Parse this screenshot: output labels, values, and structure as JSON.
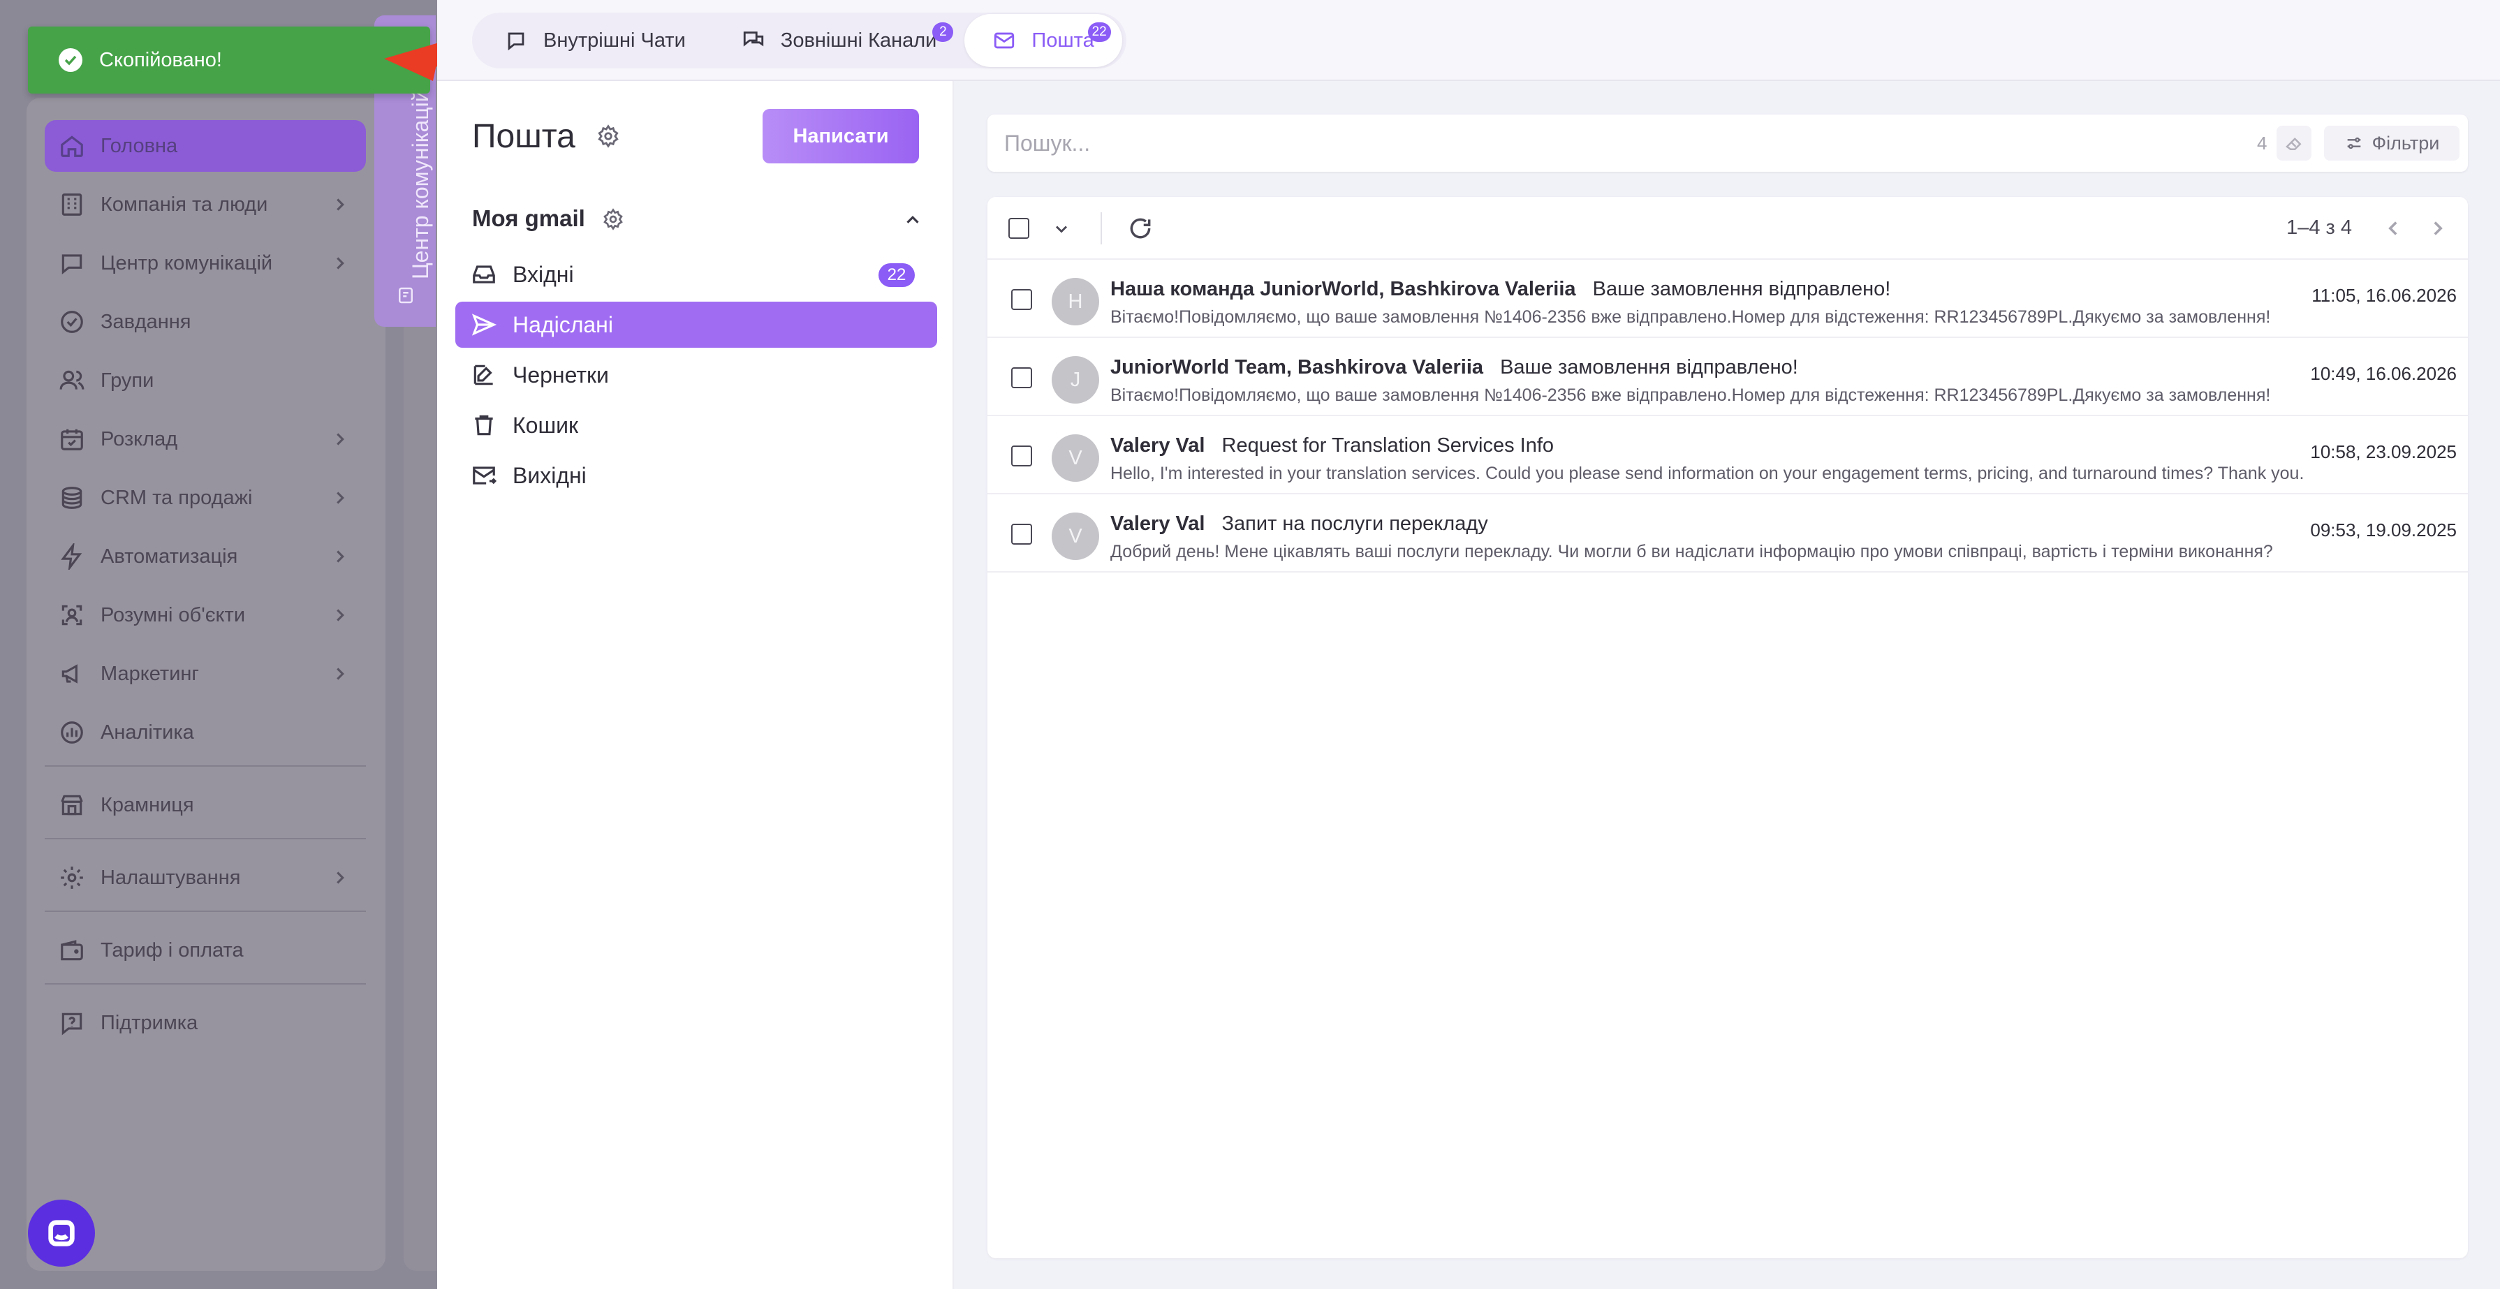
{
  "toast": {
    "message": "Скопійовано!"
  },
  "sidebar": {
    "vertical_tab": "Центр комунікацій",
    "items": [
      {
        "label": "Головна",
        "icon": "home-icon",
        "chevron": false
      },
      {
        "label": "Компанія та люди",
        "icon": "building-icon",
        "chevron": true
      },
      {
        "label": "Центр комунікацій",
        "icon": "chat-icon",
        "chevron": true
      },
      {
        "label": "Завдання",
        "icon": "check-circle-icon",
        "chevron": false
      },
      {
        "label": "Групи",
        "icon": "users-icon",
        "chevron": false
      },
      {
        "label": "Розклад",
        "icon": "calendar-icon",
        "chevron": true
      },
      {
        "label": "CRM та продажі",
        "icon": "coins-icon",
        "chevron": true
      },
      {
        "label": "Автоматизація",
        "icon": "bolt-icon",
        "chevron": true
      },
      {
        "label": "Розумні об'єкти",
        "icon": "scan-icon",
        "chevron": true
      },
      {
        "label": "Маркетинг",
        "icon": "megaphone-icon",
        "chevron": true
      },
      {
        "label": "Аналітика",
        "icon": "chart-icon",
        "chevron": false
      }
    ],
    "store": "Крамниця",
    "settings": "Налаштування",
    "billing": "Тариф і оплата",
    "support": "Підтримка"
  },
  "tabs": [
    {
      "label": "Внутрішні Чати",
      "badge": ""
    },
    {
      "label": "Зовнішні Канали",
      "badge": "2"
    },
    {
      "label": "Пошта",
      "badge": "22"
    }
  ],
  "mail": {
    "title": "Пошта",
    "compose_label": "Написати",
    "account": "Моя gmail",
    "folders": [
      {
        "label": "Вхідні",
        "badge": "22"
      },
      {
        "label": "Надіслані",
        "badge": ""
      },
      {
        "label": "Чернетки",
        "badge": ""
      },
      {
        "label": "Кошик",
        "badge": ""
      },
      {
        "label": "Вихідні",
        "badge": ""
      }
    ]
  },
  "search": {
    "placeholder": "Пошук...",
    "count": "4",
    "filters_label": "Фільтри"
  },
  "pager": {
    "label": "1–4 з 4"
  },
  "messages": [
    {
      "initial": "Н",
      "sender": "Наша команда JuniorWorld, Bashkirova Valeriia",
      "subject": "Ваше замовлення відправлено!",
      "preview": "Вітаємо!Повідомляємо, що ваше замовлення №1406-2356 вже відправлено.Номер для відстеження: RR123456789PL.Дякуємо за замовлення!",
      "date": "11:05, 16.06.2026"
    },
    {
      "initial": "J",
      "sender": "JuniorWorld Team, Bashkirova Valeriia",
      "subject": "Ваше замовлення відправлено!",
      "preview": "Вітаємо!Повідомляємо, що ваше замовлення №1406-2356 вже відправлено.Номер для відстеження: RR123456789PL.Дякуємо за замовлення!",
      "date": "10:49, 16.06.2026"
    },
    {
      "initial": "V",
      "sender": "Valery Val",
      "subject": "Request for Translation Services Info",
      "preview": "Hello, I'm interested in your translation services. Could you please send information on your engagement terms, pricing, and turnaround times? Thank you.",
      "date": "10:58, 23.09.2025"
    },
    {
      "initial": "V",
      "sender": "Valery Val",
      "subject": "Запит на послуги перекладу",
      "preview": "Добрий день! Мене цікавлять ваші послуги перекладу. Чи могли б ви надіслати інформацію про умови співпраці, вартість і терміни виконання?",
      "date": "09:53, 19.09.2025"
    }
  ]
}
